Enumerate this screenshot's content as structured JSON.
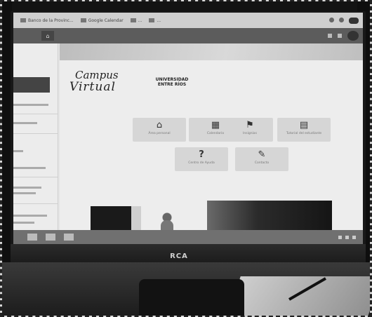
{
  "browser": {
    "bookmarks": [
      {
        "label": "Banco de la Provinc..."
      },
      {
        "label": "Google Calendar"
      },
      {
        "label": "..."
      },
      {
        "label": "..."
      }
    ]
  },
  "portal": {
    "logo_text_1": "Campus",
    "logo_text_2": "Virtual",
    "institution_line_1": "UNIVERSIDAD",
    "institution_line_2": "ENTRE RÍOS",
    "institution_badge": ""
  },
  "tiles": [
    {
      "icon": "home-icon",
      "glyph": "⌂",
      "label": "Área personal"
    },
    {
      "icon": "calendar-icon",
      "glyph": "▦",
      "label": "Calendario"
    },
    {
      "icon": "bookmark-icon",
      "glyph": "⚑",
      "label": "Insignias"
    },
    {
      "icon": "book-icon",
      "glyph": "▤",
      "label": "Tutorial del estudiante"
    },
    {
      "icon": "help-icon",
      "glyph": "?",
      "label": "Centro de Ayuda"
    },
    {
      "icon": "edit-icon",
      "glyph": "✎",
      "label": "Contacto"
    }
  ],
  "monitor": {
    "brand": "RCA"
  }
}
